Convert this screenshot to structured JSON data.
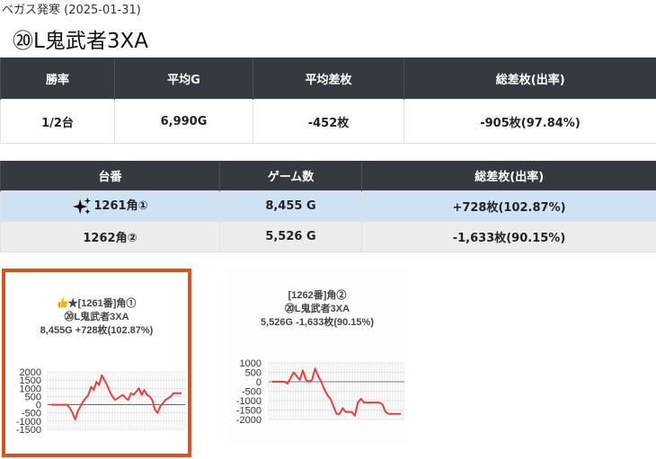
{
  "header": {
    "subtitle": "ベガス発寒 (2025-01-31)",
    "title": "⑳L鬼武者3XA"
  },
  "summary": {
    "headers": [
      "勝率",
      "平均G",
      "平均差枚",
      "総差枚(出率)"
    ],
    "values": [
      "1/2台",
      "6,990G",
      "-452枚",
      "-905枚(97.84%)"
    ]
  },
  "machines": {
    "headers": [
      "台番",
      "ゲーム数",
      "総差枚(出率)"
    ],
    "rows": [
      {
        "name": "1261角①",
        "games": "8,455 G",
        "diff": "+728枚(102.87%)",
        "icon": "sparkle-icon"
      },
      {
        "name": "1262角②",
        "games": "5,526 G",
        "diff": "-1,633枚(90.15%)"
      }
    ]
  },
  "colors": {
    "accent": "#d9541a",
    "line": "#e8413c",
    "header_bg": "#343a40",
    "selected_row": "#cfe2f3"
  },
  "charts": [
    {
      "caption_line1": "★[1261番]角①",
      "caption_line2": "⑳L鬼武者3XA",
      "caption_line3": "8,455G +728枚(102.87%)",
      "icon": "thumbs-up-icon",
      "yticks": [
        "2000",
        "1500",
        "1000",
        "500",
        "0",
        "-500",
        "-1000",
        "-1500"
      ],
      "chart_data": {
        "type": "line",
        "ylim": [
          -1500,
          2000
        ],
        "values": [
          0,
          0,
          0,
          0,
          0,
          0,
          0,
          -200,
          -500,
          -900,
          -400,
          -100,
          200,
          400,
          600,
          1100,
          900,
          1400,
          1200,
          1800,
          1500,
          1200,
          800,
          500,
          300,
          400,
          500,
          600,
          400,
          300,
          700,
          600,
          800,
          1000,
          600,
          900,
          600,
          500,
          300,
          -300,
          -500,
          -100,
          100,
          300,
          400,
          500,
          700,
          700,
          700,
          700
        ]
      }
    },
    {
      "caption_line1": "[1262番]角②",
      "caption_line2": "⑳L鬼武者3XA",
      "caption_line3": "5,526G -1,633枚(90.15%)",
      "yticks": [
        "1000",
        "500",
        "0",
        "-500",
        "-1000",
        "-1500",
        "-2000"
      ],
      "chart_data": {
        "type": "line",
        "ylim": [
          -2000,
          1000
        ],
        "values": [
          0,
          0,
          0,
          0,
          0,
          -100,
          200,
          500,
          300,
          100,
          600,
          100,
          0,
          100,
          700,
          300,
          0,
          -400,
          -700,
          -900,
          -1300,
          -1700,
          -1700,
          -1400,
          -1600,
          -1600,
          -1600,
          -1800,
          -1100,
          -900,
          -1100,
          -1100,
          -1100,
          -1100,
          -1100,
          -1100,
          -1200,
          -1600,
          -1700,
          -1700,
          -1700,
          -1700,
          -1700
        ]
      }
    }
  ]
}
